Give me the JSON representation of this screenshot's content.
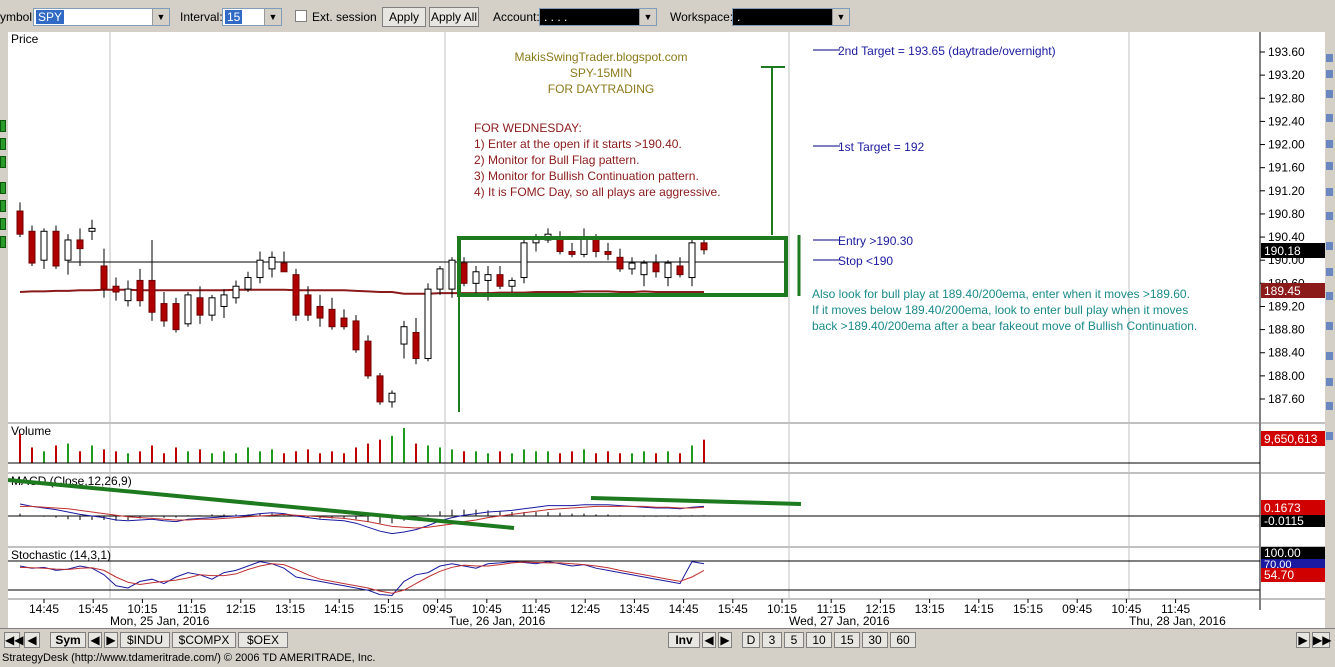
{
  "toolbar": {
    "symbol_label": "ymbol:",
    "symbol_value": "SPY",
    "interval_label": "Interval:",
    "interval_value": "15",
    "ext_session_label": "Ext. session",
    "apply_label": "Apply",
    "apply_all_label": "Apply All",
    "account_label": "Account:",
    "account_value": ". .   .   .",
    "workspace_label": "Workspace:",
    "workspace_value": "."
  },
  "panels": {
    "price_label": "Price",
    "volume_label": "Volume",
    "macd_label": "MACD (Close,12,26,9)",
    "stoch_label": "Stochastic (14,3,1)"
  },
  "annotations": {
    "blog": "MakisSwingTrader.blogspot.com",
    "symbol_interval": "SPY-15MIN",
    "purpose": "FOR DAYTRADING",
    "plan_title": "FOR WEDNESDAY:",
    "plan_1": "1) Enter at the open if it starts >190.40.",
    "plan_2": "2) Monitor for Bull Flag pattern.",
    "plan_3": "3) Monitor for Bullish Continuation pattern.",
    "plan_4": "4) It is FOMC Day, so all plays are aggressive.",
    "target2": "2nd Target = 193.65 (daytrade/overnight)",
    "target1": "1st Target = 192",
    "entry": "Entry >190.30",
    "stop": "Stop <190",
    "alt_1": "Also look for bull play at 189.40/200ema, enter when it moves >189.60.",
    "alt_2": "If it moves below 189.40/200ema, look to enter bull play when it moves",
    "alt_3": "back >189.40/200ema after a bear fakeout move of Bullish Continuation."
  },
  "price_axis_ticks": [
    "193.60",
    "193.20",
    "192.80",
    "192.40",
    "192.00",
    "191.60",
    "191.20",
    "190.80",
    "190.40",
    "190.00",
    "189.60",
    "189.20",
    "188.80",
    "188.40",
    "188.00",
    "187.60"
  ],
  "badges": {
    "last_price": "190.18",
    "ema_price": "189.45",
    "volume": "9,650,613",
    "macd_1": "0.1673",
    "macd_2": "-0.0115",
    "stoch_1": "100.00",
    "stoch_2": "70.00",
    "stoch_3": "54.70"
  },
  "time_ticks": [
    "14:45",
    "15:45",
    "10:15",
    "11:15",
    "12:15",
    "13:15",
    "14:15",
    "15:15",
    "09:45",
    "10:45",
    "11:45",
    "12:45",
    "13:45",
    "14:45",
    "15:45",
    "10:15",
    "11:15",
    "12:15",
    "13:15",
    "14:15",
    "15:15",
    "09:45",
    "10:45",
    "11:45"
  ],
  "date_labels": [
    "Mon, 25 Jan, 2016",
    "Tue, 26 Jan, 2016",
    "Wed, 27 Jan, 2016",
    "Thu, 28 Jan, 2016"
  ],
  "nav": {
    "sym": "Sym",
    "tab_indu": "$INDU",
    "tab_compx": "$COMPX",
    "tab_oex": "$OEX",
    "inv": "Inv",
    "periods": [
      "D",
      "3",
      "5",
      "10",
      "15",
      "30",
      "60"
    ]
  },
  "status_text": "StrategyDesk (http://www.tdameritrade.com/) © 2006 TD AMERITRADE, Inc.",
  "chart_data": {
    "type": "candlestick",
    "y_range": [
      187.4,
      193.8
    ],
    "bars": [
      {
        "o": 190.85,
        "h": 191.0,
        "l": 190.4,
        "c": 190.45
      },
      {
        "o": 190.5,
        "h": 190.6,
        "l": 189.9,
        "c": 189.95
      },
      {
        "o": 190.0,
        "h": 190.55,
        "l": 189.85,
        "c": 190.5
      },
      {
        "o": 190.5,
        "h": 190.6,
        "l": 189.85,
        "c": 189.9
      },
      {
        "o": 190.0,
        "h": 190.45,
        "l": 189.75,
        "c": 190.35
      },
      {
        "o": 190.35,
        "h": 190.55,
        "l": 189.9,
        "c": 190.2
      },
      {
        "o": 190.5,
        "h": 190.7,
        "l": 190.35,
        "c": 190.55
      },
      {
        "o": 189.9,
        "h": 190.2,
        "l": 189.35,
        "c": 189.5
      },
      {
        "o": 189.55,
        "h": 189.7,
        "l": 189.3,
        "c": 189.45
      },
      {
        "o": 189.3,
        "h": 189.65,
        "l": 189.2,
        "c": 189.5
      },
      {
        "o": 189.65,
        "h": 189.85,
        "l": 189.2,
        "c": 189.3
      },
      {
        "o": 189.65,
        "h": 190.35,
        "l": 188.95,
        "c": 189.1
      },
      {
        "o": 189.25,
        "h": 189.45,
        "l": 188.85,
        "c": 188.95
      },
      {
        "o": 189.25,
        "h": 189.35,
        "l": 188.75,
        "c": 188.8
      },
      {
        "o": 188.9,
        "h": 189.45,
        "l": 188.85,
        "c": 189.4
      },
      {
        "o": 189.35,
        "h": 189.55,
        "l": 188.9,
        "c": 189.05
      },
      {
        "o": 189.05,
        "h": 189.4,
        "l": 188.95,
        "c": 189.35
      },
      {
        "o": 189.2,
        "h": 189.5,
        "l": 189.0,
        "c": 189.4
      },
      {
        "o": 189.35,
        "h": 189.65,
        "l": 189.25,
        "c": 189.55
      },
      {
        "o": 189.5,
        "h": 189.8,
        "l": 189.45,
        "c": 189.7
      },
      {
        "o": 189.7,
        "h": 190.15,
        "l": 189.6,
        "c": 190.0
      },
      {
        "o": 189.85,
        "h": 190.15,
        "l": 189.7,
        "c": 190.05
      },
      {
        "o": 189.95,
        "h": 190.15,
        "l": 189.8,
        "c": 189.8
      },
      {
        "o": 189.75,
        "h": 189.85,
        "l": 188.95,
        "c": 189.05
      },
      {
        "o": 189.4,
        "h": 189.55,
        "l": 188.95,
        "c": 189.05
      },
      {
        "o": 189.2,
        "h": 189.4,
        "l": 188.85,
        "c": 189.0
      },
      {
        "o": 189.15,
        "h": 189.35,
        "l": 188.8,
        "c": 188.85
      },
      {
        "o": 189.0,
        "h": 189.15,
        "l": 188.8,
        "c": 188.85
      },
      {
        "o": 188.95,
        "h": 189.05,
        "l": 188.4,
        "c": 188.45
      },
      {
        "o": 188.6,
        "h": 188.7,
        "l": 187.95,
        "c": 188.0
      },
      {
        "o": 188.0,
        "h": 188.05,
        "l": 187.5,
        "c": 187.55
      },
      {
        "o": 187.55,
        "h": 187.75,
        "l": 187.45,
        "c": 187.7
      },
      {
        "o": 188.55,
        "h": 188.95,
        "l": 188.3,
        "c": 188.85
      },
      {
        "o": 188.75,
        "h": 189.0,
        "l": 188.2,
        "c": 188.3
      },
      {
        "o": 188.3,
        "h": 189.6,
        "l": 188.25,
        "c": 189.5
      },
      {
        "o": 189.5,
        "h": 189.9,
        "l": 189.4,
        "c": 189.85
      },
      {
        "o": 189.5,
        "h": 190.05,
        "l": 189.35,
        "c": 190.0
      },
      {
        "o": 189.95,
        "h": 190.05,
        "l": 189.55,
        "c": 189.6
      },
      {
        "o": 189.6,
        "h": 189.9,
        "l": 189.4,
        "c": 189.8
      },
      {
        "o": 189.65,
        "h": 189.9,
        "l": 189.3,
        "c": 189.75
      },
      {
        "o": 189.75,
        "h": 189.9,
        "l": 189.5,
        "c": 189.55
      },
      {
        "o": 189.55,
        "h": 189.7,
        "l": 189.45,
        "c": 189.65
      },
      {
        "o": 189.7,
        "h": 190.35,
        "l": 189.6,
        "c": 190.3
      },
      {
        "o": 190.3,
        "h": 190.45,
        "l": 190.15,
        "c": 190.4
      },
      {
        "o": 190.35,
        "h": 190.55,
        "l": 190.3,
        "c": 190.45
      },
      {
        "o": 190.4,
        "h": 190.5,
        "l": 190.1,
        "c": 190.15
      },
      {
        "o": 190.15,
        "h": 190.3,
        "l": 190.05,
        "c": 190.1
      },
      {
        "o": 190.1,
        "h": 190.55,
        "l": 190.05,
        "c": 190.4
      },
      {
        "o": 190.4,
        "h": 190.45,
        "l": 190.05,
        "c": 190.15
      },
      {
        "o": 190.15,
        "h": 190.3,
        "l": 190.0,
        "c": 190.1
      },
      {
        "o": 190.05,
        "h": 190.2,
        "l": 189.8,
        "c": 189.85
      },
      {
        "o": 189.85,
        "h": 190.05,
        "l": 189.75,
        "c": 189.95
      },
      {
        "o": 189.75,
        "h": 190.0,
        "l": 189.55,
        "c": 189.95
      },
      {
        "o": 189.95,
        "h": 190.1,
        "l": 189.7,
        "c": 189.8
      },
      {
        "o": 189.7,
        "h": 190.0,
        "l": 189.55,
        "c": 189.95
      },
      {
        "o": 189.9,
        "h": 190.05,
        "l": 189.7,
        "c": 189.75
      },
      {
        "o": 189.7,
        "h": 190.35,
        "l": 189.55,
        "c": 190.3
      },
      {
        "o": 190.3,
        "h": 190.4,
        "l": 190.1,
        "c": 190.18
      }
    ],
    "ema200": [
      189.45,
      189.46,
      189.46,
      189.47,
      189.47,
      189.48,
      189.48,
      189.49,
      189.49,
      189.49,
      189.48,
      189.48,
      189.48,
      189.48,
      189.48,
      189.48,
      189.48,
      189.48,
      189.49,
      189.49,
      189.49,
      189.49,
      189.49,
      189.48,
      189.48,
      189.48,
      189.48,
      189.48,
      189.47,
      189.46,
      189.45,
      189.45,
      189.42,
      189.42,
      189.42,
      189.43,
      189.43,
      189.43,
      189.43,
      189.43,
      189.44,
      189.44,
      189.44,
      189.45,
      189.45,
      189.45,
      189.45,
      189.46,
      189.46,
      189.46,
      189.45,
      189.45,
      189.46,
      189.45,
      189.45,
      189.45,
      189.45,
      189.45
    ],
    "volume": [
      15,
      8,
      6,
      9,
      10,
      6,
      9,
      7,
      6,
      5,
      6,
      9,
      5,
      8,
      6,
      7,
      5,
      6,
      5,
      8,
      6,
      7,
      5,
      6,
      7,
      5,
      6,
      5,
      8,
      10,
      12,
      14,
      18,
      10,
      9,
      8,
      7,
      6,
      6,
      5,
      6,
      5,
      7,
      6,
      6,
      5,
      6,
      7,
      5,
      6,
      5,
      5,
      6,
      5,
      6,
      5,
      9,
      12
    ],
    "macd": [
      0.15,
      0.12,
      0.1,
      0.08,
      0.05,
      0.02,
      0.0,
      -0.02,
      -0.05,
      -0.06,
      -0.05,
      -0.04,
      -0.06,
      -0.07,
      -0.04,
      -0.03,
      -0.02,
      -0.01,
      0.0,
      0.01,
      0.03,
      0.04,
      0.03,
      0.0,
      -0.02,
      -0.04,
      -0.05,
      -0.06,
      -0.09,
      -0.14,
      -0.19,
      -0.22,
      -0.2,
      -0.17,
      -0.12,
      -0.06,
      -0.02,
      0.01,
      0.03,
      0.05,
      0.06,
      0.07,
      0.09,
      0.11,
      0.13,
      0.13,
      0.13,
      0.14,
      0.14,
      0.14,
      0.13,
      0.12,
      0.11,
      0.1,
      0.1,
      0.09,
      0.11,
      0.12
    ],
    "macd_signal": [
      0.12,
      0.12,
      0.11,
      0.1,
      0.09,
      0.07,
      0.05,
      0.03,
      0.01,
      -0.01,
      -0.02,
      -0.03,
      -0.04,
      -0.05,
      -0.05,
      -0.04,
      -0.04,
      -0.03,
      -0.02,
      -0.01,
      0.0,
      0.01,
      0.02,
      0.01,
      0.0,
      -0.01,
      -0.02,
      -0.03,
      -0.05,
      -0.07,
      -0.1,
      -0.13,
      -0.14,
      -0.15,
      -0.14,
      -0.12,
      -0.1,
      -0.07,
      -0.05,
      -0.02,
      0.0,
      0.02,
      0.04,
      0.06,
      0.08,
      0.09,
      0.1,
      0.11,
      0.12,
      0.12,
      0.12,
      0.12,
      0.12,
      0.11,
      0.11,
      0.1,
      0.1,
      0.11
    ],
    "stoch_k": [
      75,
      70,
      72,
      65,
      68,
      75,
      70,
      55,
      30,
      25,
      40,
      45,
      35,
      50,
      60,
      55,
      45,
      60,
      65,
      75,
      85,
      80,
      70,
      50,
      45,
      40,
      35,
      30,
      25,
      20,
      10,
      8,
      40,
      55,
      60,
      75,
      80,
      75,
      70,
      80,
      82,
      85,
      83,
      80,
      85,
      80,
      75,
      78,
      70,
      65,
      60,
      55,
      50,
      45,
      40,
      35,
      85,
      80
    ],
    "stoch_d": [
      72,
      71,
      70,
      68,
      67,
      70,
      71,
      65,
      50,
      38,
      33,
      37,
      40,
      43,
      48,
      55,
      53,
      53,
      57,
      67,
      75,
      80,
      78,
      67,
      55,
      45,
      40,
      35,
      30,
      25,
      18,
      13,
      20,
      35,
      50,
      63,
      72,
      77,
      75,
      75,
      78,
      82,
      84,
      83,
      82,
      82,
      80,
      78,
      75,
      71,
      65,
      60,
      55,
      50,
      45,
      40,
      50,
      65
    ]
  }
}
